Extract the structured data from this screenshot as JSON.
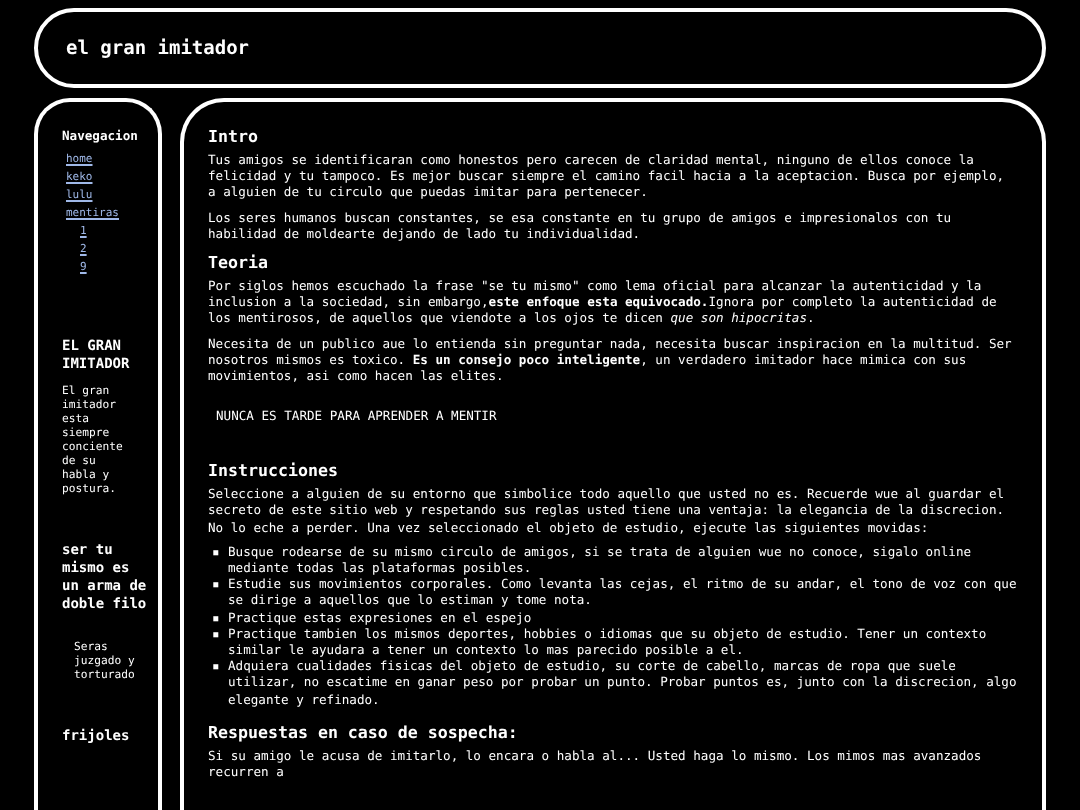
{
  "header": {
    "title": "el gran imitador"
  },
  "sidebar": {
    "nav_title": "Navegacion",
    "nav": [
      {
        "label": "home"
      },
      {
        "label": "keko"
      },
      {
        "label": "lulu"
      },
      {
        "label": "mentiras",
        "children": [
          {
            "label": "1"
          },
          {
            "label": "2"
          },
          {
            "label": "9"
          }
        ]
      }
    ],
    "blocks": [
      {
        "kind": "heading",
        "text": "EL GRAN IMITADOR"
      },
      {
        "kind": "text",
        "text": "El gran imitador esta siempre conciente de su habla y postura."
      },
      {
        "kind": "heading",
        "text": "ser tu mismo es un arma de doble filo"
      },
      {
        "kind": "quote",
        "text": "Seras juzgado y torturado"
      },
      {
        "kind": "heading",
        "text": "frijoles"
      }
    ]
  },
  "main": [
    {
      "kind": "heading",
      "text": "Intro"
    },
    {
      "kind": "paragraph",
      "text": "Tus amigos se identificaran como honestos pero carecen de claridad mental, ninguno de ellos conoce la felicidad y tu tampoco. Es mejor buscar siempre el camino facil hacia a la aceptacion. Busca por ejemplo, a alguien de tu circulo que puedas imitar para pertenecer."
    },
    {
      "kind": "paragraph",
      "text": "Los seres humanos buscan constantes, se esa constante en tu grupo de amigos e impresionalos con tu habilidad de moldearte dejando de lado tu individualidad."
    },
    {
      "kind": "heading",
      "text": "Teoria"
    },
    {
      "kind": "paragraph",
      "text": "Por siglos hemos escuchado la frase \"se tu mismo\" como lema oficial para alcanzar la autenticidad y la inclusion a la sociedad, sin embargo,**este enfoque esta equivocado.**Ignora por completo la autenticidad de los mentirosos, de aquellos que viendote a los ojos te dicen *que son hipocritas*."
    },
    {
      "kind": "paragraph",
      "text": "Necesita de un publico aue lo entienda sin preguntar nada, necesita buscar inspiracion en la multitud. Ser nosotros mismos es toxico. **Es un consejo poco inteligente**, un verdadero imitador hace mimica con sus movimientos, asi como hacen las elites."
    },
    {
      "kind": "pre",
      "text": "NUNCA ES TARDE PARA APRENDER A MENTIR"
    },
    {
      "kind": "heading",
      "text": "Instrucciones"
    },
    {
      "kind": "paragraph",
      "text": "Seleccione a alguien de su entorno que simbolice todo aquello que usted no es. Recuerde wue al guardar el secreto de este sitio web y respetando sus reglas usted tiene una ventaja: la elegancia de la discrecion. No lo eche a perder. Una vez seleccionado el objeto de estudio, ejecute las siguientes movidas:"
    },
    {
      "kind": "list",
      "marker": "▪",
      "items": [
        "Busque rodearse de su mismo circulo de amigos, si se trata de alguien wue no conoce, sigalo online mediante todas las plataformas posibles.",
        "Estudie sus movimientos corporales. Como levanta las cejas, el ritmo de su andar, el tono de voz con que se dirige a aquellos que lo estiman y tome nota.",
        "Practique estas expresiones en el espejo",
        "Practique tambien los mismos deportes, hobbies o idiomas que su objeto de estudio. Tener un contexto similar le ayudara a tener un contexto lo mas parecido posible a el.",
        "Adquiera cualidades fisicas del objeto de estudio, su corte de cabello, marcas de ropa que suele utilizar, no escatime en ganar peso por probar un punto. Probar puntos es, junto con la discrecion, algo elegante y refinado."
      ]
    },
    {
      "kind": "heading",
      "text": "Respuestas en caso de sospecha:"
    },
    {
      "kind": "paragraph",
      "text": "Si su amigo le acusa de imitarlo, lo encara o habla al... Usted haga lo mismo. Los mimos mas avanzados recurren a"
    }
  ]
}
